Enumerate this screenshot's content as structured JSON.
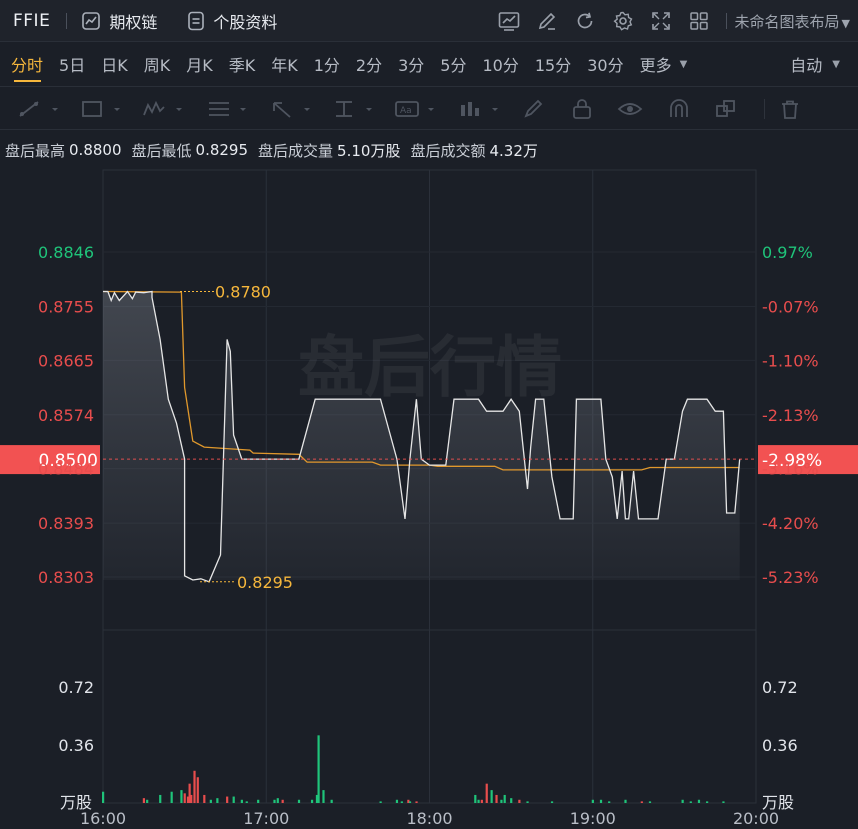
{
  "header": {
    "symbol": "FFIE",
    "options_chain": "期权链",
    "stock_profile": "个股资料",
    "layout_name": "未命名图表布局"
  },
  "periods": {
    "tabs": [
      "分时",
      "5日",
      "日K",
      "周K",
      "月K",
      "季K",
      "年K",
      "1分",
      "2分",
      "3分",
      "5分",
      "10分",
      "15分",
      "30分",
      "更多"
    ],
    "active": "分时",
    "auto_label": "自动"
  },
  "info": {
    "high_label": "盘后最高",
    "high_value": "0.8800",
    "low_label": "盘后最低",
    "low_value": "0.8295",
    "volume_label": "盘后成交量",
    "volume_value": "5.10万股",
    "amount_label": "盘后成交额",
    "amount_value": "4.32万"
  },
  "watermark": "盘后行情",
  "colors": {
    "up": "#e84d4d",
    "down": "#1fc47a",
    "avg_line": "#e0982c",
    "price_line": "#e6e6e6",
    "accent": "#f6b73c",
    "current_tag": "#f25252"
  },
  "chart_data": {
    "type": "line",
    "x_ticks": [
      "16:00",
      "17:00",
      "18:00",
      "19:00",
      "20:00"
    ],
    "price_ticks_left": [
      "0.8846",
      "0.8755",
      "0.8665",
      "0.8574",
      "0.8484",
      "0.8393",
      "0.8303"
    ],
    "pct_ticks_right": [
      "0.97%",
      "-0.07%",
      "-1.10%",
      "-2.13%",
      "-3.16%",
      "-4.20%",
      "-5.23%"
    ],
    "price_range": [
      0.8303,
      0.8846
    ],
    "current_price": "0.8500",
    "current_pct": "-2.98%",
    "high_marker": "0.8780",
    "low_marker": "0.8295",
    "volume_ticks": [
      "0.72",
      "0.36"
    ],
    "volume_unit": "万股",
    "price_series": [
      {
        "t": 0.0,
        "p": 0.878
      },
      {
        "t": 0.03,
        "p": 0.878
      },
      {
        "t": 0.05,
        "p": 0.8765
      },
      {
        "t": 0.07,
        "p": 0.8778
      },
      {
        "t": 0.1,
        "p": 0.8765
      },
      {
        "t": 0.15,
        "p": 0.878
      },
      {
        "t": 0.18,
        "p": 0.8768
      },
      {
        "t": 0.2,
        "p": 0.8779
      },
      {
        "t": 0.25,
        "p": 0.8778
      },
      {
        "t": 0.3,
        "p": 0.878
      },
      {
        "t": 0.3,
        "p": 0.877
      },
      {
        "t": 0.35,
        "p": 0.87
      },
      {
        "t": 0.4,
        "p": 0.86
      },
      {
        "t": 0.45,
        "p": 0.856
      },
      {
        "t": 0.5,
        "p": 0.85
      },
      {
        "t": 0.5,
        "p": 0.8305
      },
      {
        "t": 0.55,
        "p": 0.8298
      },
      {
        "t": 0.6,
        "p": 0.83
      },
      {
        "t": 0.65,
        "p": 0.8295
      },
      {
        "t": 0.72,
        "p": 0.834
      },
      {
        "t": 0.76,
        "p": 0.87
      },
      {
        "t": 0.78,
        "p": 0.868
      },
      {
        "t": 0.8,
        "p": 0.854
      },
      {
        "t": 0.85,
        "p": 0.85
      },
      {
        "t": 0.95,
        "p": 0.85
      },
      {
        "t": 1.2,
        "p": 0.85
      },
      {
        "t": 1.3,
        "p": 0.86
      },
      {
        "t": 1.5,
        "p": 0.86
      },
      {
        "t": 1.7,
        "p": 0.86
      },
      {
        "t": 1.8,
        "p": 0.85
      },
      {
        "t": 1.85,
        "p": 0.84
      },
      {
        "t": 1.88,
        "p": 0.85
      },
      {
        "t": 1.92,
        "p": 0.86
      },
      {
        "t": 1.95,
        "p": 0.85
      },
      {
        "t": 2.0,
        "p": 0.849
      },
      {
        "t": 2.1,
        "p": 0.849
      },
      {
        "t": 2.15,
        "p": 0.86
      },
      {
        "t": 2.3,
        "p": 0.86
      },
      {
        "t": 2.35,
        "p": 0.858
      },
      {
        "t": 2.45,
        "p": 0.858
      },
      {
        "t": 2.5,
        "p": 0.86
      },
      {
        "t": 2.55,
        "p": 0.858
      },
      {
        "t": 2.6,
        "p": 0.845
      },
      {
        "t": 2.62,
        "p": 0.852
      },
      {
        "t": 2.65,
        "p": 0.86
      },
      {
        "t": 2.7,
        "p": 0.86
      },
      {
        "t": 2.75,
        "p": 0.847
      },
      {
        "t": 2.8,
        "p": 0.84
      },
      {
        "t": 2.88,
        "p": 0.84
      },
      {
        "t": 2.9,
        "p": 0.86
      },
      {
        "t": 3.05,
        "p": 0.86
      },
      {
        "t": 3.08,
        "p": 0.85
      },
      {
        "t": 3.12,
        "p": 0.847
      },
      {
        "t": 3.15,
        "p": 0.84
      },
      {
        "t": 3.18,
        "p": 0.848
      },
      {
        "t": 3.2,
        "p": 0.84
      },
      {
        "t": 3.22,
        "p": 0.84
      },
      {
        "t": 3.25,
        "p": 0.848
      },
      {
        "t": 3.28,
        "p": 0.84
      },
      {
        "t": 3.4,
        "p": 0.84
      },
      {
        "t": 3.45,
        "p": 0.85
      },
      {
        "t": 3.5,
        "p": 0.85
      },
      {
        "t": 3.55,
        "p": 0.858
      },
      {
        "t": 3.58,
        "p": 0.86
      },
      {
        "t": 3.7,
        "p": 0.86
      },
      {
        "t": 3.75,
        "p": 0.858
      },
      {
        "t": 3.8,
        "p": 0.858
      },
      {
        "t": 3.82,
        "p": 0.841
      },
      {
        "t": 3.87,
        "p": 0.841
      },
      {
        "t": 3.9,
        "p": 0.85
      }
    ],
    "avg_series": [
      {
        "t": 0.0,
        "p": 0.878
      },
      {
        "t": 0.48,
        "p": 0.8779
      },
      {
        "t": 0.5,
        "p": 0.862
      },
      {
        "t": 0.55,
        "p": 0.853
      },
      {
        "t": 0.62,
        "p": 0.852
      },
      {
        "t": 0.9,
        "p": 0.8515
      },
      {
        "t": 0.92,
        "p": 0.851
      },
      {
        "t": 1.2,
        "p": 0.8508
      },
      {
        "t": 1.25,
        "p": 0.8495
      },
      {
        "t": 1.65,
        "p": 0.8495
      },
      {
        "t": 1.7,
        "p": 0.849
      },
      {
        "t": 2.0,
        "p": 0.849
      },
      {
        "t": 2.05,
        "p": 0.8488
      },
      {
        "t": 2.4,
        "p": 0.8488
      },
      {
        "t": 2.45,
        "p": 0.8482
      },
      {
        "t": 3.3,
        "p": 0.8482
      },
      {
        "t": 3.35,
        "p": 0.8486
      },
      {
        "t": 3.9,
        "p": 0.8486
      }
    ],
    "volume_bars": [
      {
        "t": 0.0,
        "v": 0.07,
        "d": "down"
      },
      {
        "t": 0.25,
        "v": 0.03,
        "d": "up"
      },
      {
        "t": 0.27,
        "v": 0.02,
        "d": "down"
      },
      {
        "t": 0.35,
        "v": 0.05,
        "d": "down"
      },
      {
        "t": 0.42,
        "v": 0.07,
        "d": "down"
      },
      {
        "t": 0.48,
        "v": 0.08,
        "d": "down"
      },
      {
        "t": 0.5,
        "v": 0.06,
        "d": "up"
      },
      {
        "t": 0.52,
        "v": 0.04,
        "d": "up"
      },
      {
        "t": 0.53,
        "v": 0.12,
        "d": "up"
      },
      {
        "t": 0.54,
        "v": 0.05,
        "d": "up"
      },
      {
        "t": 0.56,
        "v": 0.2,
        "d": "up"
      },
      {
        "t": 0.58,
        "v": 0.16,
        "d": "up"
      },
      {
        "t": 0.62,
        "v": 0.05,
        "d": "up"
      },
      {
        "t": 0.66,
        "v": 0.02,
        "d": "down"
      },
      {
        "t": 0.7,
        "v": 0.03,
        "d": "down"
      },
      {
        "t": 0.76,
        "v": 0.04,
        "d": "up"
      },
      {
        "t": 0.8,
        "v": 0.04,
        "d": "down"
      },
      {
        "t": 0.85,
        "v": 0.02,
        "d": "down"
      },
      {
        "t": 0.88,
        "v": 0.01,
        "d": "down"
      },
      {
        "t": 0.95,
        "v": 0.02,
        "d": "down"
      },
      {
        "t": 1.05,
        "v": 0.02,
        "d": "down"
      },
      {
        "t": 1.07,
        "v": 0.03,
        "d": "down"
      },
      {
        "t": 1.1,
        "v": 0.02,
        "d": "up"
      },
      {
        "t": 1.2,
        "v": 0.02,
        "d": "down"
      },
      {
        "t": 1.28,
        "v": 0.02,
        "d": "down"
      },
      {
        "t": 1.31,
        "v": 0.05,
        "d": "down"
      },
      {
        "t": 1.32,
        "v": 0.42,
        "d": "down"
      },
      {
        "t": 1.35,
        "v": 0.08,
        "d": "down"
      },
      {
        "t": 1.4,
        "v": 0.02,
        "d": "down"
      },
      {
        "t": 1.7,
        "v": 0.01,
        "d": "down"
      },
      {
        "t": 1.8,
        "v": 0.02,
        "d": "down"
      },
      {
        "t": 1.83,
        "v": 0.01,
        "d": "down"
      },
      {
        "t": 1.87,
        "v": 0.02,
        "d": "up"
      },
      {
        "t": 1.88,
        "v": 0.01,
        "d": "down"
      },
      {
        "t": 1.92,
        "v": 0.01,
        "d": "up"
      },
      {
        "t": 2.28,
        "v": 0.05,
        "d": "down"
      },
      {
        "t": 2.3,
        "v": 0.02,
        "d": "down"
      },
      {
        "t": 2.32,
        "v": 0.02,
        "d": "up"
      },
      {
        "t": 2.35,
        "v": 0.12,
        "d": "up"
      },
      {
        "t": 2.38,
        "v": 0.08,
        "d": "down"
      },
      {
        "t": 2.41,
        "v": 0.05,
        "d": "up"
      },
      {
        "t": 2.44,
        "v": 0.02,
        "d": "down"
      },
      {
        "t": 2.46,
        "v": 0.05,
        "d": "down"
      },
      {
        "t": 2.5,
        "v": 0.03,
        "d": "down"
      },
      {
        "t": 2.55,
        "v": 0.02,
        "d": "up"
      },
      {
        "t": 2.6,
        "v": 0.01,
        "d": "down"
      },
      {
        "t": 2.75,
        "v": 0.01,
        "d": "down"
      },
      {
        "t": 3.0,
        "v": 0.02,
        "d": "down"
      },
      {
        "t": 3.05,
        "v": 0.02,
        "d": "down"
      },
      {
        "t": 3.1,
        "v": 0.01,
        "d": "down"
      },
      {
        "t": 3.2,
        "v": 0.02,
        "d": "down"
      },
      {
        "t": 3.3,
        "v": 0.01,
        "d": "up"
      },
      {
        "t": 3.35,
        "v": 0.01,
        "d": "down"
      },
      {
        "t": 3.55,
        "v": 0.02,
        "d": "down"
      },
      {
        "t": 3.6,
        "v": 0.01,
        "d": "down"
      },
      {
        "t": 3.65,
        "v": 0.02,
        "d": "down"
      },
      {
        "t": 3.7,
        "v": 0.01,
        "d": "down"
      },
      {
        "t": 3.8,
        "v": 0.01,
        "d": "down"
      }
    ]
  }
}
